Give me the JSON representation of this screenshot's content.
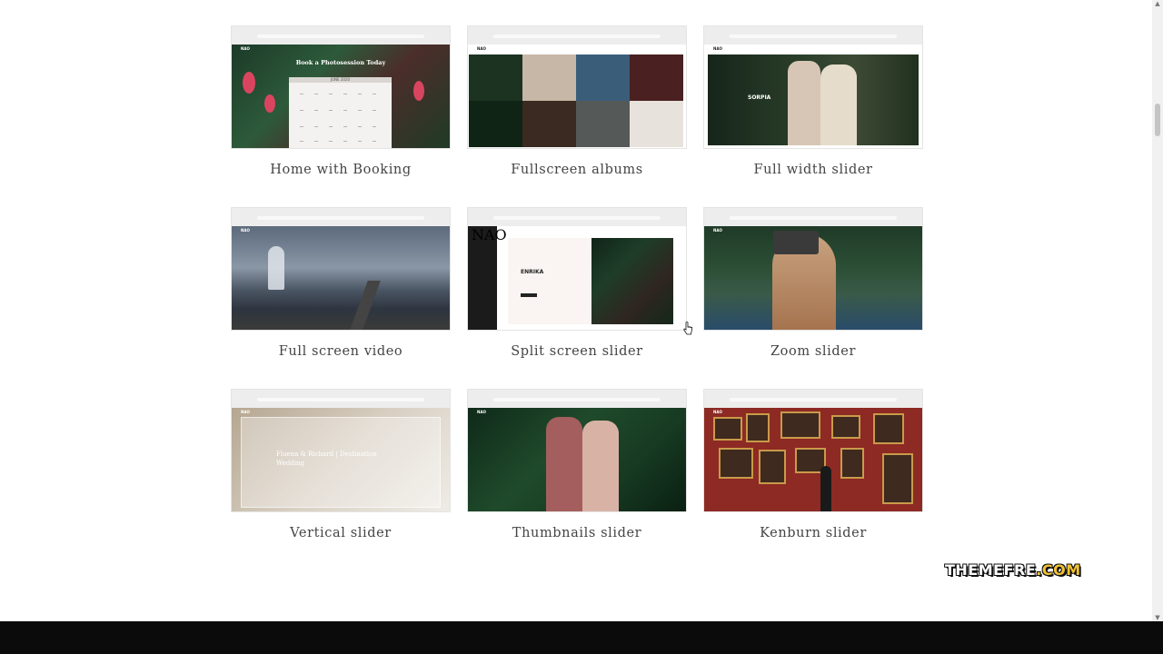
{
  "demos": [
    {
      "label": "Home with Booking",
      "logo": "NAO",
      "headline": "Book a Photosession Today",
      "calendar_month": "JUNE 2020"
    },
    {
      "label": "Fullscreen albums",
      "logo": "NAO"
    },
    {
      "label": "Full width slider",
      "logo": "NAO",
      "slide_title": "SORPIA"
    },
    {
      "label": "Full screen video",
      "logo": "NAO"
    },
    {
      "label": "Split screen slider",
      "logo": "NAO",
      "slide_title": "ENRIKA"
    },
    {
      "label": "Zoom slider",
      "logo": "NAO"
    },
    {
      "label": "Vertical slider",
      "logo": "NAO",
      "slide_title": "Fluena & Richard | Destination Wedding"
    },
    {
      "label": "Thumbnails slider",
      "logo": "NAO"
    },
    {
      "label": "Kenburn slider",
      "logo": "NAO"
    }
  ],
  "watermark": {
    "main": "THEMEFRE",
    "accent": ".COM"
  },
  "colors": {
    "footer": "#0b0b0b",
    "label_text": "#444444",
    "watermark_accent": "#f1c232"
  }
}
